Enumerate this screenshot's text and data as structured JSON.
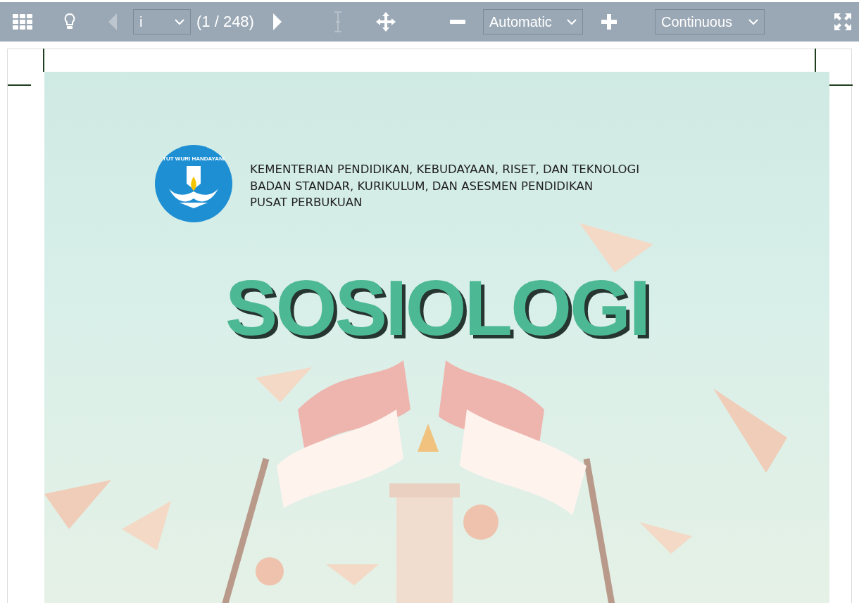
{
  "toolbar": {
    "prev_button": {
      "disabled": true
    },
    "page_select": {
      "value": "i"
    },
    "page_count": "(1 / 248)",
    "next_button": {
      "disabled": false
    },
    "text_select_button": {
      "disabled": true
    },
    "zoom_select": {
      "value": "Automatic"
    },
    "scroll_mode_select": {
      "value": "Continuous"
    }
  },
  "cover": {
    "logo_text": "TUT WURI HANDAYANI",
    "header_lines": [
      "KEMENTERIAN PENDIDIKAN, KEBUDAYAAN, RISET, DAN TEKNOLOGI",
      "BADAN STANDAR, KURIKULUM, DAN ASESMEN PENDIDIKAN",
      "PUSAT PERBUKUAN"
    ],
    "title": "SOSIOLOGI"
  }
}
